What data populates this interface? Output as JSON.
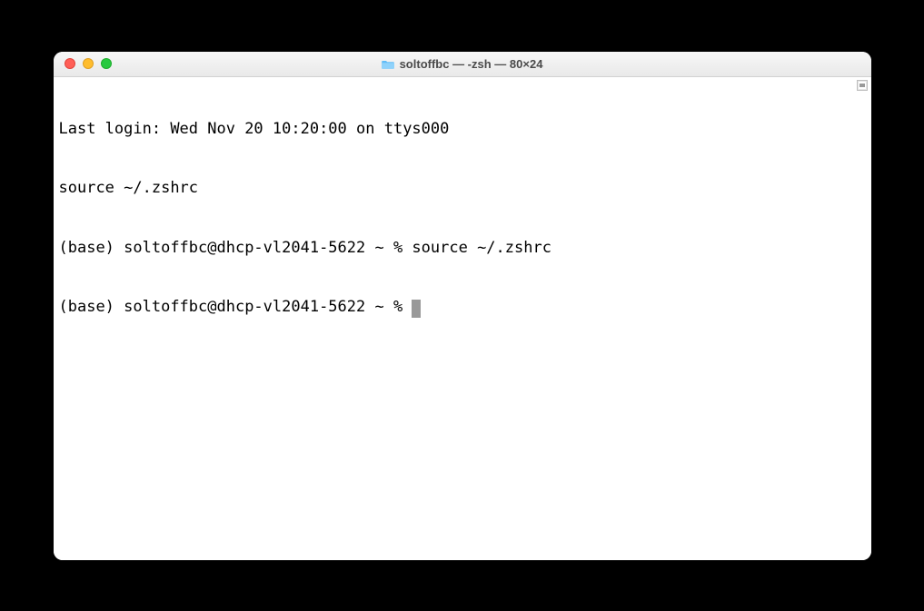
{
  "window": {
    "title": "soltoffbc — -zsh — 80×24"
  },
  "terminal": {
    "lines": [
      "Last login: Wed Nov 20 10:20:00 on ttys000",
      "source ~/.zshrc",
      "(base) soltoffbc@dhcp-vl2041-5622 ~ % source ~/.zshrc"
    ],
    "prompt": "(base) soltoffbc@dhcp-vl2041-5622 ~ % "
  }
}
